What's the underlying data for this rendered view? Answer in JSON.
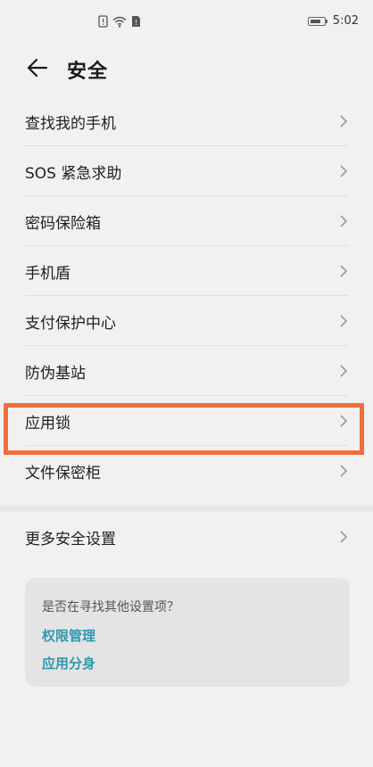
{
  "status_bar": {
    "time": "5:02",
    "icons": [
      "notification-icon",
      "wifi-icon",
      "sim-icon"
    ],
    "battery_level": 0.8
  },
  "header": {
    "title": "安全"
  },
  "items": [
    {
      "label": "查找我的手机"
    },
    {
      "label": "SOS 紧急求助"
    },
    {
      "label": "密码保险箱"
    },
    {
      "label": "手机盾"
    },
    {
      "label": "支付保护中心"
    },
    {
      "label": "防伪基站"
    },
    {
      "label": "应用锁"
    },
    {
      "label": "文件保密柜"
    }
  ],
  "more_item": {
    "label": "更多安全设置"
  },
  "suggestion_card": {
    "question": "是否在寻找其他设置项？",
    "links": [
      "权限管理",
      "应用分身"
    ]
  },
  "colors": {
    "highlight": "#ef6f3b",
    "link": "#2e98b0",
    "background": "#f1f1f1"
  }
}
